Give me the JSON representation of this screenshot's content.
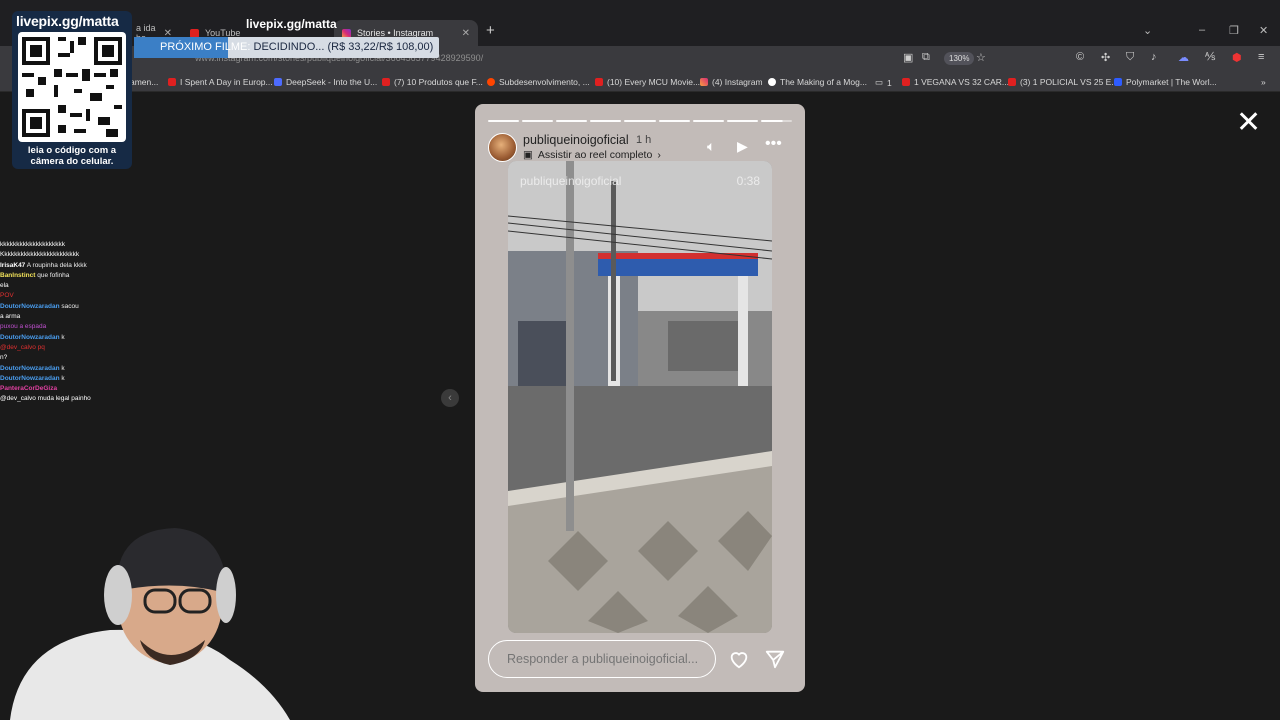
{
  "browser": {
    "tabs": [
      {
        "label": "a ida ho"
      },
      {
        "label": "YouTube"
      },
      {
        "label": "Stories • Instagram"
      }
    ],
    "url": "www.instagram.com/stories/publiqueinoigoficial/3664565779428929590/",
    "zoom": "130%",
    "bookmarks": [
      {
        "label": "amen..."
      },
      {
        "label": "I Spent A Day in Europ..."
      },
      {
        "label": "DeepSeek - Into the U..."
      },
      {
        "label": "(7) 10 Produtos que F..."
      },
      {
        "label": "Subdesenvolvimento, ..."
      },
      {
        "label": "(10) Every MCU Movie..."
      },
      {
        "label": "(4) Instagram"
      },
      {
        "label": "The Making of a Mog..."
      },
      {
        "label": "1"
      },
      {
        "label": "1 VEGANA VS 32 CAR..."
      },
      {
        "label": "(3) 1 POLICIAL VS 25 E..."
      },
      {
        "label": "Polymarket | The Worl..."
      }
    ]
  },
  "story": {
    "username": "publiqueinoigoficial",
    "time_ago": "1 h",
    "reel_link": "Assistir ao reel completo",
    "overlay_username": "publiqueinoigoficial",
    "overlay_time": "0:38",
    "reply_placeholder": "Responder a publiqueinoigoficial...",
    "segments_total": 9,
    "active_segment": 9
  },
  "stream": {
    "qr_title": "livepix.gg/matta",
    "qr_caption": "leia o código com a câmera do celular.",
    "livepix_url": "livepix.gg/matta",
    "filme_prefix": "PRÓXIMO FILME:",
    "filme_text": "DECIDINDO... (R$ 33,22/R$ 108,00)",
    "chat": [
      {
        "user": "",
        "msg": "kkkkkkkkkkkkkkkkkkkk",
        "color": "#ffffff"
      },
      {
        "user": "",
        "msg": "",
        "color": "#e03030"
      },
      {
        "user": "",
        "msg": "Kkkkkkkkkkkkkkkkkkkkkkkk",
        "color": "#ffffff"
      },
      {
        "user": "IrisaK47",
        "msg": "A roupinha dela kkkk",
        "color": "#ffffff"
      },
      {
        "user": "BanInstinct",
        "msg": "que fofinha",
        "color": "#f2e25a"
      },
      {
        "user": "",
        "msg": "ela",
        "color": "#ffffff"
      },
      {
        "user": "",
        "msg": "POV",
        "color": "#e03030"
      },
      {
        "user": "DoutorNowzaradan",
        "msg": "sacou",
        "color": "#4a9ef0"
      },
      {
        "user": "",
        "msg": "a arma",
        "color": "#ffffff"
      },
      {
        "user": "",
        "msg": "puxou a espada",
        "color": "#c050d0"
      },
      {
        "user": "DoutorNowzaradan",
        "msg": "k",
        "color": "#4a9ef0"
      },
      {
        "user": "",
        "msg": "@dev_calvo pq",
        "color": "#e03030"
      },
      {
        "user": "",
        "msg": "n?",
        "color": "#ffffff"
      },
      {
        "user": "DoutorNowzaradan",
        "msg": "k",
        "color": "#4a9ef0"
      },
      {
        "user": "DoutorNowzaradan",
        "msg": "k",
        "color": "#4a9ef0"
      },
      {
        "user": "PanteraCorDeGiza",
        "msg": "",
        "color": "#e040a0"
      },
      {
        "user": "",
        "msg": "@dev_calvo muda legal painho",
        "color": "#ffffff"
      }
    ]
  },
  "colors": {
    "story_bg": "#c2bbb8",
    "viewer_bg": "#1a1a1a",
    "accent_blue": "#3b7fc6"
  }
}
